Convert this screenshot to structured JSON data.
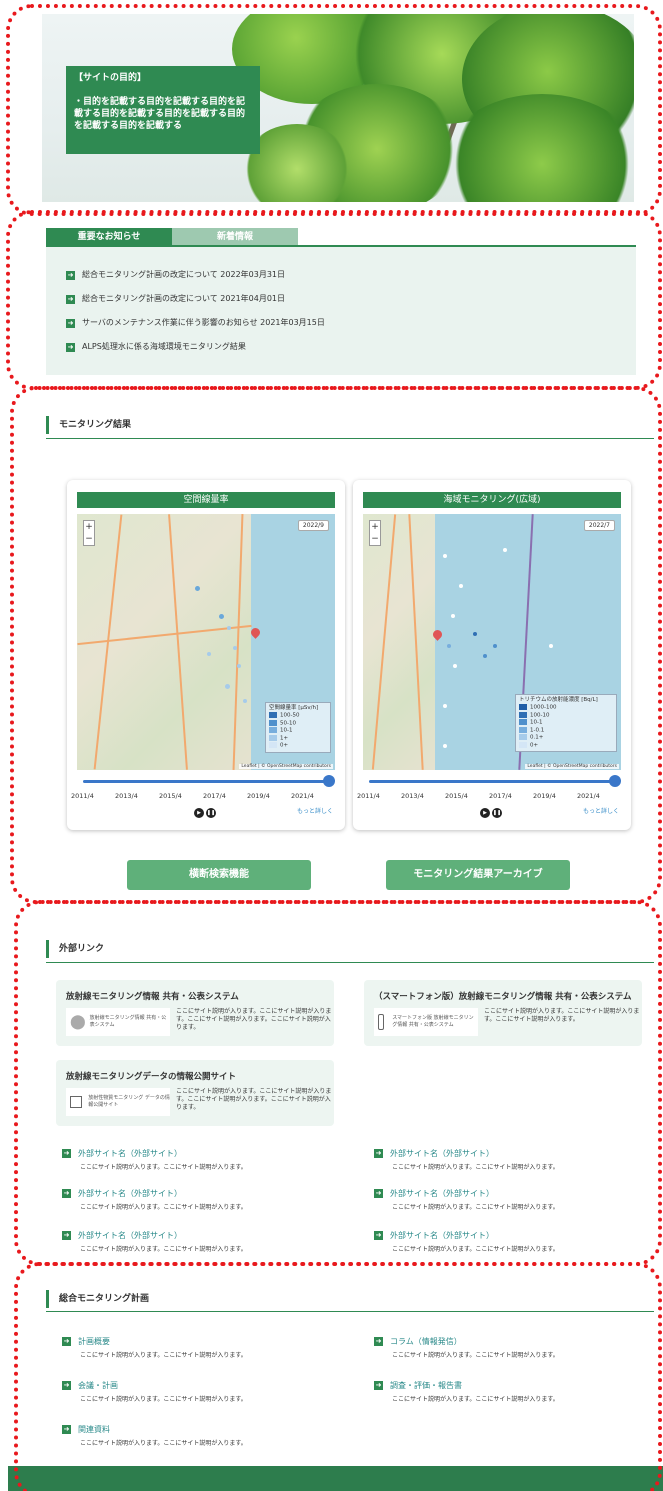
{
  "hero": {
    "purpose_title": "【サイトの目的】",
    "purpose_text": "・目的を記載する目的を記載する目的を記載する目的を記載する目的を記載する目的を記載する目的を記載する"
  },
  "notices": {
    "tabs": [
      {
        "label": "重要なお知らせ",
        "active": true
      },
      {
        "label": "新着情報",
        "active": false
      }
    ],
    "items": [
      "総合モニタリング計画の改定について 2022年03月31日",
      "総合モニタリング計画の改定について 2021年04月01日",
      "サーバのメンテナンス作業に伴う影響のお知らせ 2021年03月15日",
      "ALPS処理水に係る海域環境モニタリング結果"
    ]
  },
  "monitoring": {
    "heading": "モニタリング結果",
    "cards": [
      {
        "title": "空間線量率",
        "year_badge": "2022/9",
        "legend_title": "空間線量率 [μSv/h]",
        "legend_items": [
          "100-50",
          "50-10",
          "10-1",
          "1+",
          "0+"
        ],
        "legend_colors": [
          "#2f6fb4",
          "#4f90cc",
          "#78aedd",
          "#a6cbea",
          "#d4e6f6"
        ],
        "attribution": "Leaflet | © OpenStreetMap contributors",
        "ticks": [
          "2011/4",
          "2013/4",
          "2015/4",
          "2017/4",
          "2019/4",
          "2021/4"
        ],
        "more": "もっと詳しく"
      },
      {
        "title": "海域モニタリング(広域)",
        "year_badge": "2022/7",
        "legend_title": "トリチウムの放射能濃度 [Bq/L]",
        "legend_items": [
          "1000-100",
          "100-10",
          "10-1",
          "1-0.1",
          "0.1+",
          "0+"
        ],
        "legend_colors": [
          "#1f5ea8",
          "#2f6fb4",
          "#4f90cc",
          "#78aedd",
          "#a6cbea",
          "#d4e6f6"
        ],
        "attribution": "Leaflet | © OpenStreetMap contributors",
        "ticks": [
          "2011/4",
          "2013/4",
          "2015/4",
          "2017/4",
          "2019/4",
          "2021/4"
        ],
        "more": "もっと詳しく"
      }
    ],
    "zoom_in": "+",
    "zoom_out": "−",
    "buttons": [
      "横断検索機能",
      "モニタリング結果アーカイブ"
    ]
  },
  "external": {
    "heading": "外部リンク",
    "featured": [
      {
        "title": "放射線モニタリング情報 共有・公表システム",
        "logo_text": "放射線モニタリング情報 共有・公表システム",
        "desc": "ここにサイト説明が入ります。ここにサイト説明が入ります。ここにサイト説明が入ります。ここにサイト説明が入ります。"
      },
      {
        "title": "（スマートフォン版）放射線モニタリング情報 共有・公表システム",
        "logo_text": "スマートフォン版 放射線モニタリング情報 共有・公表システム",
        "desc": "ここにサイト説明が入ります。ここにサイト説明が入ります。ここにサイト説明が入ります。"
      },
      {
        "title": "放射線モニタリングデータの情報公開サイト",
        "logo_text": "放射性物質モニタリング データの情報公開サイト",
        "desc": "ここにサイト説明が入ります。ここにサイト説明が入ります。ここにサイト説明が入ります。ここにサイト説明が入ります。"
      }
    ],
    "links": [
      {
        "title": "外部サイト名（外部サイト）",
        "desc": "ここにサイト説明が入ります。ここにサイト説明が入ります。"
      },
      {
        "title": "外部サイト名（外部サイト）",
        "desc": "ここにサイト説明が入ります。ここにサイト説明が入ります。"
      },
      {
        "title": "外部サイト名（外部サイト）",
        "desc": "ここにサイト説明が入ります。ここにサイト説明が入ります。"
      },
      {
        "title": "外部サイト名（外部サイト）",
        "desc": "ここにサイト説明が入ります。ここにサイト説明が入ります。"
      },
      {
        "title": "外部サイト名（外部サイト）",
        "desc": "ここにサイト説明が入ります。ここにサイト説明が入ります。"
      },
      {
        "title": "外部サイト名（外部サイト）",
        "desc": "ここにサイト説明が入ります。ここにサイト説明が入ります。"
      }
    ]
  },
  "plan": {
    "heading": "総合モニタリング計画",
    "links": [
      {
        "title": "計画概要",
        "desc": "ここにサイト説明が入ります。ここにサイト説明が入ります。"
      },
      {
        "title": "コラム（情報発信）",
        "desc": "ここにサイト説明が入ります。ここにサイト説明が入ります。"
      },
      {
        "title": "会議・計画",
        "desc": "ここにサイト説明が入ります。ここにサイト説明が入ります。"
      },
      {
        "title": "調査・評価・報告書",
        "desc": "ここにサイト説明が入ります。ここにサイト説明が入ります。"
      },
      {
        "title": "関連資料",
        "desc": "ここにサイト説明が入ります。ここにサイト説明が入ります。"
      }
    ]
  },
  "colors": {
    "brand_green": "#2f8a52",
    "annotation_red": "#e8191d"
  }
}
